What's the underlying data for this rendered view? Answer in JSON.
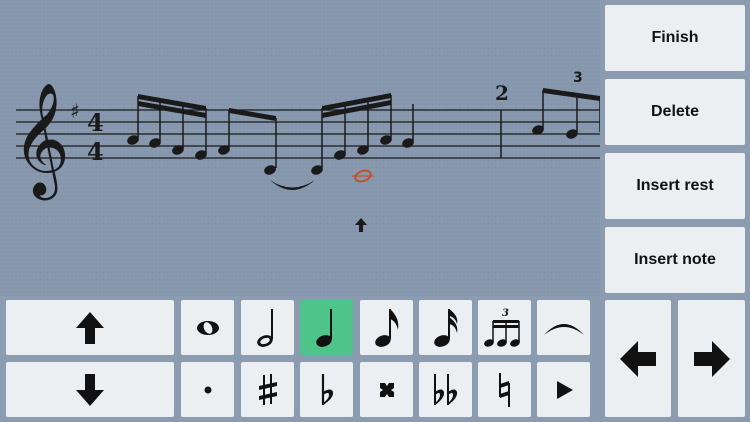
{
  "side_buttons": [
    {
      "label": "Finish"
    },
    {
      "label": "Delete"
    },
    {
      "label": "Insert rest"
    },
    {
      "label": "Insert note"
    }
  ],
  "score": {
    "clef": "treble-clef",
    "key_signature": "sharp",
    "time_signature": {
      "top": "4",
      "bottom": "4"
    },
    "measure_number": "2",
    "tuplet_label": "3"
  },
  "palette": {
    "tuplet_key_label": "3",
    "selected_duration": "quarter-note",
    "selected_color": "#4ec48a"
  },
  "colors": {
    "background": "#8b9cb0",
    "button": "#eceff1",
    "cursor_note": "#c0532e"
  }
}
